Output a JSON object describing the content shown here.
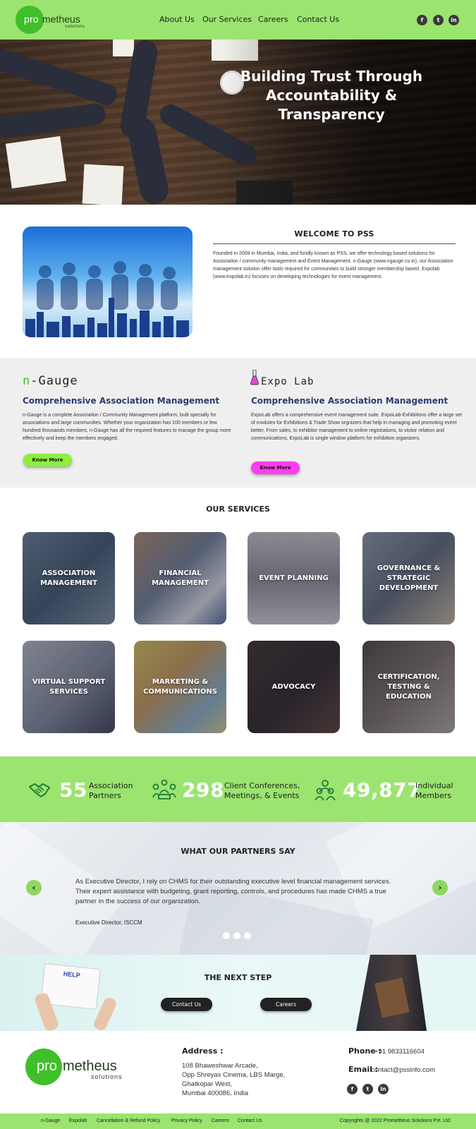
{
  "header": {
    "logo": {
      "pro": "pro",
      "metheus": "metheus",
      "solutions": "solutions"
    },
    "nav": [
      "About Us",
      "Our Services",
      "Careers",
      "Contact Us"
    ],
    "social": [
      {
        "icon": "facebook-icon",
        "glyph": "f"
      },
      {
        "icon": "twitter-icon",
        "glyph": "t"
      },
      {
        "icon": "linkedin-icon",
        "glyph": "in"
      }
    ]
  },
  "hero": {
    "line1": "Building Trust Through",
    "line2": "Accountability & Transparency"
  },
  "welcome": {
    "title": "WELCOME TO PSS",
    "body": "Founded in 2008 in Mumbai, India, and fondly known as PSS, we offer technology based solutions for Association / community management and Event Management. n-Gauge (www.ngauge.co.in), our Association management solution offer tools required for communities to build stronger membership based. Expolab (www.expolab.in) focuses on developing technologies for event management."
  },
  "products": [
    {
      "logo": "n-Gauge",
      "title": "Comprehensive Association Management",
      "text": "n-Gauge is a complete Association / Community Management platform, built specially for associations and large communities. Whether your organization has 100 members or few hundred thousands members, n-Gauge has all the required features to manage the group more effectively and keep the members engaged.",
      "button": "Know More",
      "color": "#8cf03c"
    },
    {
      "logo": "Expo Lab",
      "title": "Comprehensive Association Management",
      "text": "ExpoLab offers a comprehensive event management suite. ExpoLab-Exhibitions offer a large set of modules for Exhibitions & Trade Show orgnizers that help in managing and promoting event better. From sales, to exhibitor management to online registrations, to visitor relation and communications, ExpoLab is single window platform for exhibition organizers.",
      "button": "Know More",
      "color": "#ff3cf0"
    }
  ],
  "services": {
    "title": "OUR SERVICES",
    "items": [
      "ASSOCIATION MANAGEMENT",
      "FINANCIAL MANAGEMENT",
      "EVENT PLANNING",
      "GOVERNANCE & STRATEGIC DEVELOPMENT",
      "VIRTUAL SUPPORT SERVICES",
      "MARKETING & COMMUNICATIONS",
      "ADVOCACY",
      "CERTIFICATION, TESTING & EDUCATION"
    ]
  },
  "stats": [
    {
      "number": "55",
      "label1": "Association",
      "label2": "Partners",
      "icon": "handshake-icon"
    },
    {
      "number": "298",
      "label1": "Client Conferences,",
      "label2": "Meetings, & Events",
      "icon": "meeting-icon"
    },
    {
      "number": "49,877",
      "label1": "Individual",
      "label2": "Members",
      "icon": "members-icon"
    }
  ],
  "testimonial": {
    "title": "WHAT OUR PARTNERS SAY",
    "quote": "As Executive Director, I rely on CHMS for their outstanding executive level financial management services. Their expert assistance with budgeting, grant reporting, controls, and procedures has made CHMS a true partner in the success of our organization.",
    "author": "Executive Director, ISCCM",
    "prev": "‹",
    "next": "›"
  },
  "next_step": {
    "title": "THE NEXT STEP",
    "contact": "Contact Us",
    "careers": "Careers",
    "help_card": "HELP"
  },
  "footer": {
    "address_title": "Address :",
    "address": [
      "108 Bhaweshwar Arcade,",
      "Opp Shreyas Cinema, LBS Marge,",
      "Ghatkopar West,",
      "Mumbai 400086, India"
    ],
    "phone_title": "Phone :",
    "phone": "+91 9833116604",
    "email_title": "Email :",
    "email": "contact@pssinfo.com"
  },
  "bottom": {
    "links": [
      "n-Gauge",
      "Expolab",
      "Cancellation & Refund Policy",
      "Privacy Policy",
      "Careers",
      "Contact Us"
    ],
    "copyright": "Copyrights @ 2022 Prometheus Solutions Pvt. Ltd"
  },
  "colors": {
    "brand_green": "#9be46f",
    "logo_green": "#3fbf2a",
    "heading_navy": "#2c3a72"
  }
}
